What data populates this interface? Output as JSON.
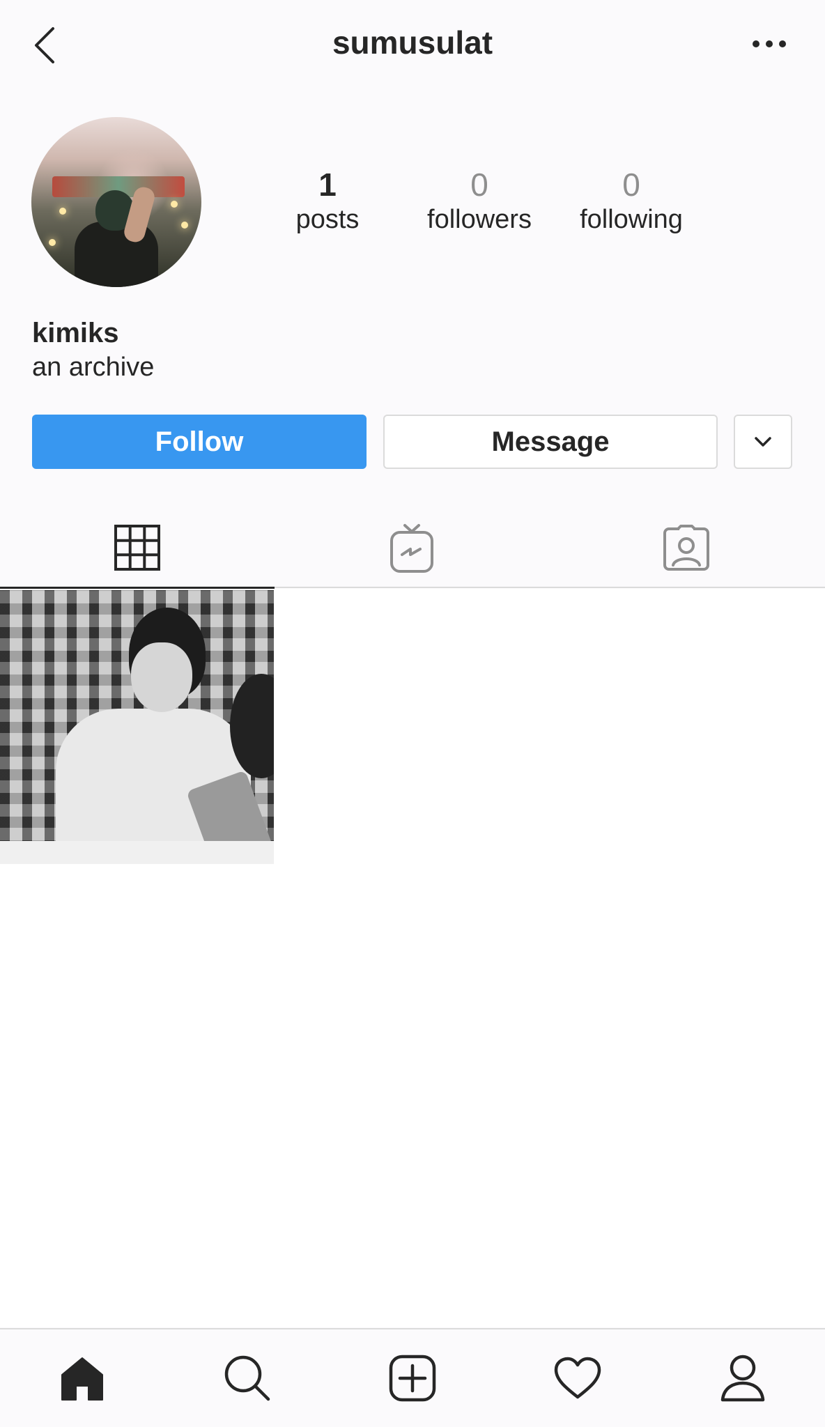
{
  "header": {
    "username": "sumusulat",
    "back_icon": "chevron-left-icon",
    "more_icon": "more-horizontal-icon"
  },
  "profile": {
    "stats": [
      {
        "count": "1",
        "label": "posts"
      },
      {
        "count": "0",
        "label": "followers"
      },
      {
        "count": "0",
        "label": "following"
      }
    ],
    "display_name": "kimiks",
    "bio": "an archive"
  },
  "actions": {
    "follow_label": "Follow",
    "message_label": "Message",
    "dropdown_icon": "chevron-down-icon"
  },
  "tabs": [
    {
      "icon": "grid-icon",
      "active": true
    },
    {
      "icon": "igtv-icon",
      "active": false
    },
    {
      "icon": "tagged-icon",
      "active": false
    }
  ],
  "posts": [
    {
      "description": "black-and-white photo thumbnail"
    }
  ],
  "bottom_nav": [
    {
      "icon": "home-icon",
      "active": true
    },
    {
      "icon": "search-icon"
    },
    {
      "icon": "add-post-icon"
    },
    {
      "icon": "heart-icon"
    },
    {
      "icon": "profile-icon"
    }
  ],
  "colors": {
    "accent": "#3897f0",
    "text": "#262626",
    "muted": "#8e8e8e",
    "border": "#dbdbdb",
    "background": "#fbfafc"
  }
}
